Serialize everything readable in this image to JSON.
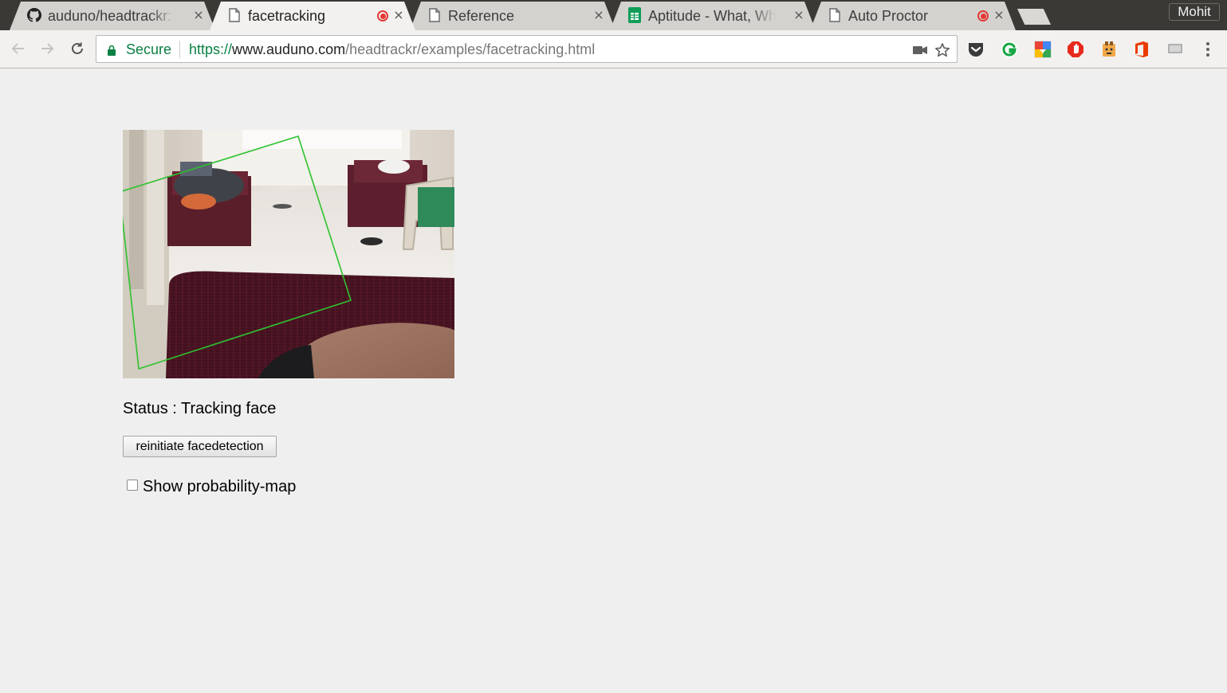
{
  "browser": {
    "tabs": [
      {
        "title": "auduno/headtrackr: J",
        "icon": "github-icon",
        "active": false,
        "recording": false
      },
      {
        "title": "facetracking",
        "icon": "page-icon",
        "active": true,
        "recording": true
      },
      {
        "title": "Reference",
        "icon": "page-icon",
        "active": false,
        "recording": false
      },
      {
        "title": "Aptitude - What, Why",
        "icon": "sheets-icon",
        "active": false,
        "recording": false
      },
      {
        "title": "Auto Proctor",
        "icon": "page-icon",
        "active": false,
        "recording": true
      }
    ],
    "close_glyph": "×",
    "profile_name": "Mohit",
    "security_label": "Secure",
    "url": {
      "scheme": "https://",
      "host": "www.auduno.com",
      "path": "/headtrackr/examples/facetracking.html"
    },
    "extensions": [
      "pocket-icon",
      "grammarly-icon",
      "google-drive-icon",
      "adblock-icon",
      "extension-icon",
      "office-icon",
      "cast-icon"
    ],
    "colors": {
      "secure_green": "#0b8043",
      "tracking_box": "#2ec22e",
      "record_red": "#e53935"
    }
  },
  "page": {
    "status_text": "Status : Tracking face",
    "reinit_button_label": "reinitiate facedetection",
    "probability_map_label": "Show probability-map",
    "probability_map_checked": false
  }
}
